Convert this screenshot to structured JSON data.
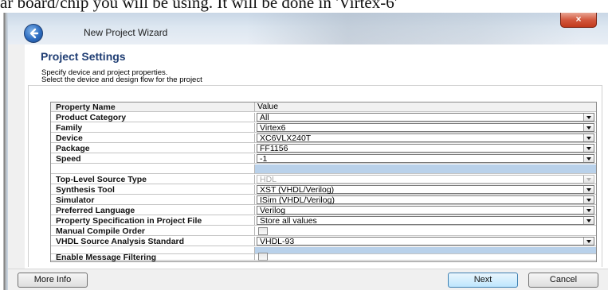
{
  "document_text": "ar board/chip you will be using. It will be done in 'Virtex-6'",
  "wizard": {
    "title": "New Project Wizard",
    "close_label": "×",
    "page_title": "Project Settings",
    "desc_line1": "Specify device and project properties.",
    "desc_line2": "Select the device and design flow for the project"
  },
  "grid": {
    "header": {
      "name": "Property Name",
      "value": "Value"
    },
    "rows": [
      {
        "name": "Product Category",
        "value": "All"
      },
      {
        "name": "Family",
        "value": "Virtex6"
      },
      {
        "name": "Device",
        "value": "XC6VLX240T"
      },
      {
        "name": "Package",
        "value": "FF1156"
      },
      {
        "name": "Speed",
        "value": "-1"
      },
      {
        "name": "Top-Level Source Type",
        "value": "HDL"
      },
      {
        "name": "Synthesis Tool",
        "value": "XST (VHDL/Verilog)"
      },
      {
        "name": "Simulator",
        "value": "ISim (VHDL/Verilog)"
      },
      {
        "name": "Preferred Language",
        "value": "Verilog"
      },
      {
        "name": "Property Specification in Project File",
        "value": "Store all values"
      },
      {
        "name": "Manual Compile Order",
        "checked": false
      },
      {
        "name": "VHDL Source Analysis Standard",
        "value": "VHDL-93"
      },
      {
        "name": "Enable Message Filtering",
        "checked": false
      }
    ]
  },
  "buttons": {
    "more_info": "More Info",
    "next": "Next",
    "cancel": "Cancel"
  },
  "colors": {
    "title_blue": "#1f3d73",
    "selected_row": "#b9d1ea",
    "close_red": "#c13a1c"
  }
}
